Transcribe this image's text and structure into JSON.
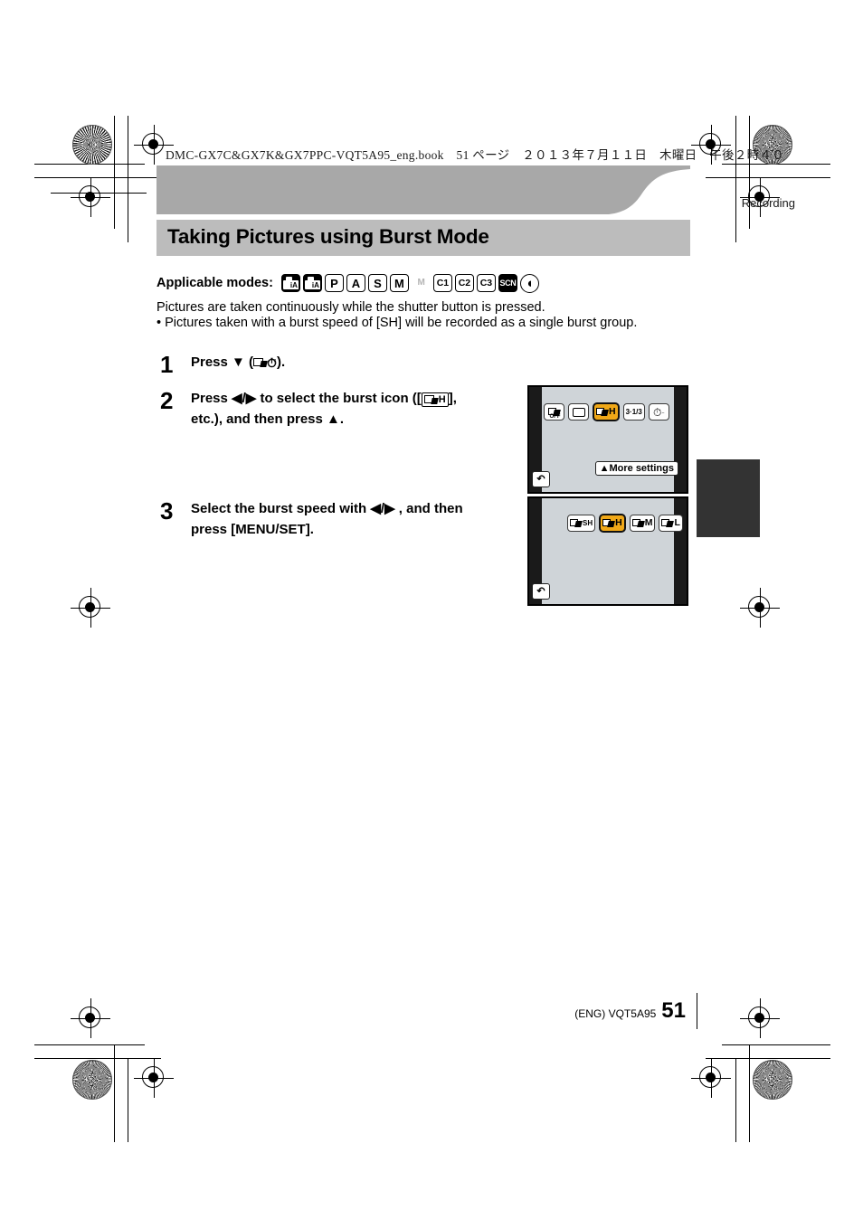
{
  "print_header": {
    "file_line": "DMC-GX7C&GX7K&GX7PPC-VQT5A95_eng.book　51 ページ　２０１３年７月１１日　木曜日　午後２時４０"
  },
  "header": {
    "chapter_tag": "Recording",
    "title": "Taking Pictures using Burst Mode"
  },
  "applicable_modes": {
    "label": "Applicable modes:",
    "items": [
      {
        "name": "intelligent-auto",
        "text": "iA",
        "style": "filled-ia"
      },
      {
        "name": "intelligent-auto-plus",
        "text": "iA+",
        "style": "filled-ia-plus"
      },
      {
        "name": "program-ae",
        "text": "P",
        "style": "outline"
      },
      {
        "name": "aperture-priority",
        "text": "A",
        "style": "outline"
      },
      {
        "name": "shutter-priority",
        "text": "S",
        "style": "outline"
      },
      {
        "name": "manual-exposure",
        "text": "M",
        "style": "outline"
      },
      {
        "name": "creative-video",
        "text": "M",
        "style": "dim"
      },
      {
        "name": "custom-1",
        "text": "C1",
        "style": "outline-small"
      },
      {
        "name": "custom-2",
        "text": "C2",
        "style": "outline-small"
      },
      {
        "name": "custom-3",
        "text": "C3",
        "style": "outline-small"
      },
      {
        "name": "scene-guide",
        "text": "SCN",
        "style": "scn"
      },
      {
        "name": "creative-control",
        "text": "◖",
        "style": "round"
      }
    ]
  },
  "body": {
    "paragraph_1": "Pictures are taken continuously while the shutter button is pressed.",
    "paragraph_2": "• Pictures taken with a burst speed of [SH] will be recorded as a single burst group."
  },
  "steps": [
    {
      "number": "1",
      "text_before": "Press ▼ (",
      "text_after": ")."
    },
    {
      "number": "2",
      "line1_before": "Press ◀/▶ to select the burst icon ([",
      "line1_icon_label": "H",
      "line1_after": "],",
      "line2": "etc.), and then press ▲."
    },
    {
      "number": "3",
      "line1": "Select the burst speed with ◀/▶ , and then",
      "line2": "press [MENU/SET]."
    }
  ],
  "lcd_screens": [
    {
      "name": "drive-mode-bar",
      "icons": [
        {
          "name": "burst-off-icon",
          "label": "OFF",
          "selected": false,
          "kind": "burst-off"
        },
        {
          "name": "single-shot-icon",
          "label": "",
          "selected": false,
          "kind": "single"
        },
        {
          "name": "burst-h-icon",
          "label": "H",
          "selected": true,
          "kind": "burst"
        },
        {
          "name": "bracket-icon",
          "label": "3·1/3",
          "selected": false,
          "kind": "text"
        },
        {
          "name": "self-timer-icon",
          "label": "",
          "selected": false,
          "kind": "timer"
        }
      ],
      "more_settings_label": "▲More settings",
      "back_button_label": "↶"
    },
    {
      "name": "burst-speed-bar",
      "icons": [
        {
          "name": "burst-sh-icon",
          "label": "SH",
          "selected": false,
          "kind": "burst"
        },
        {
          "name": "burst-h-icon",
          "label": "H",
          "selected": true,
          "kind": "burst"
        },
        {
          "name": "burst-m-icon",
          "label": "M",
          "selected": false,
          "kind": "burst"
        },
        {
          "name": "burst-l-icon",
          "label": "L",
          "selected": false,
          "kind": "burst"
        }
      ],
      "back_button_label": "↶"
    }
  ],
  "footer": {
    "doc_id": "(ENG) VQT5A95",
    "page_number": "51"
  },
  "colors": {
    "header_band": "#a8a8a8",
    "title_band": "#bcbcbc",
    "lcd_background": "#cfd4d8",
    "selection_highlight": "#f0a818",
    "side_tab": "#333333"
  }
}
